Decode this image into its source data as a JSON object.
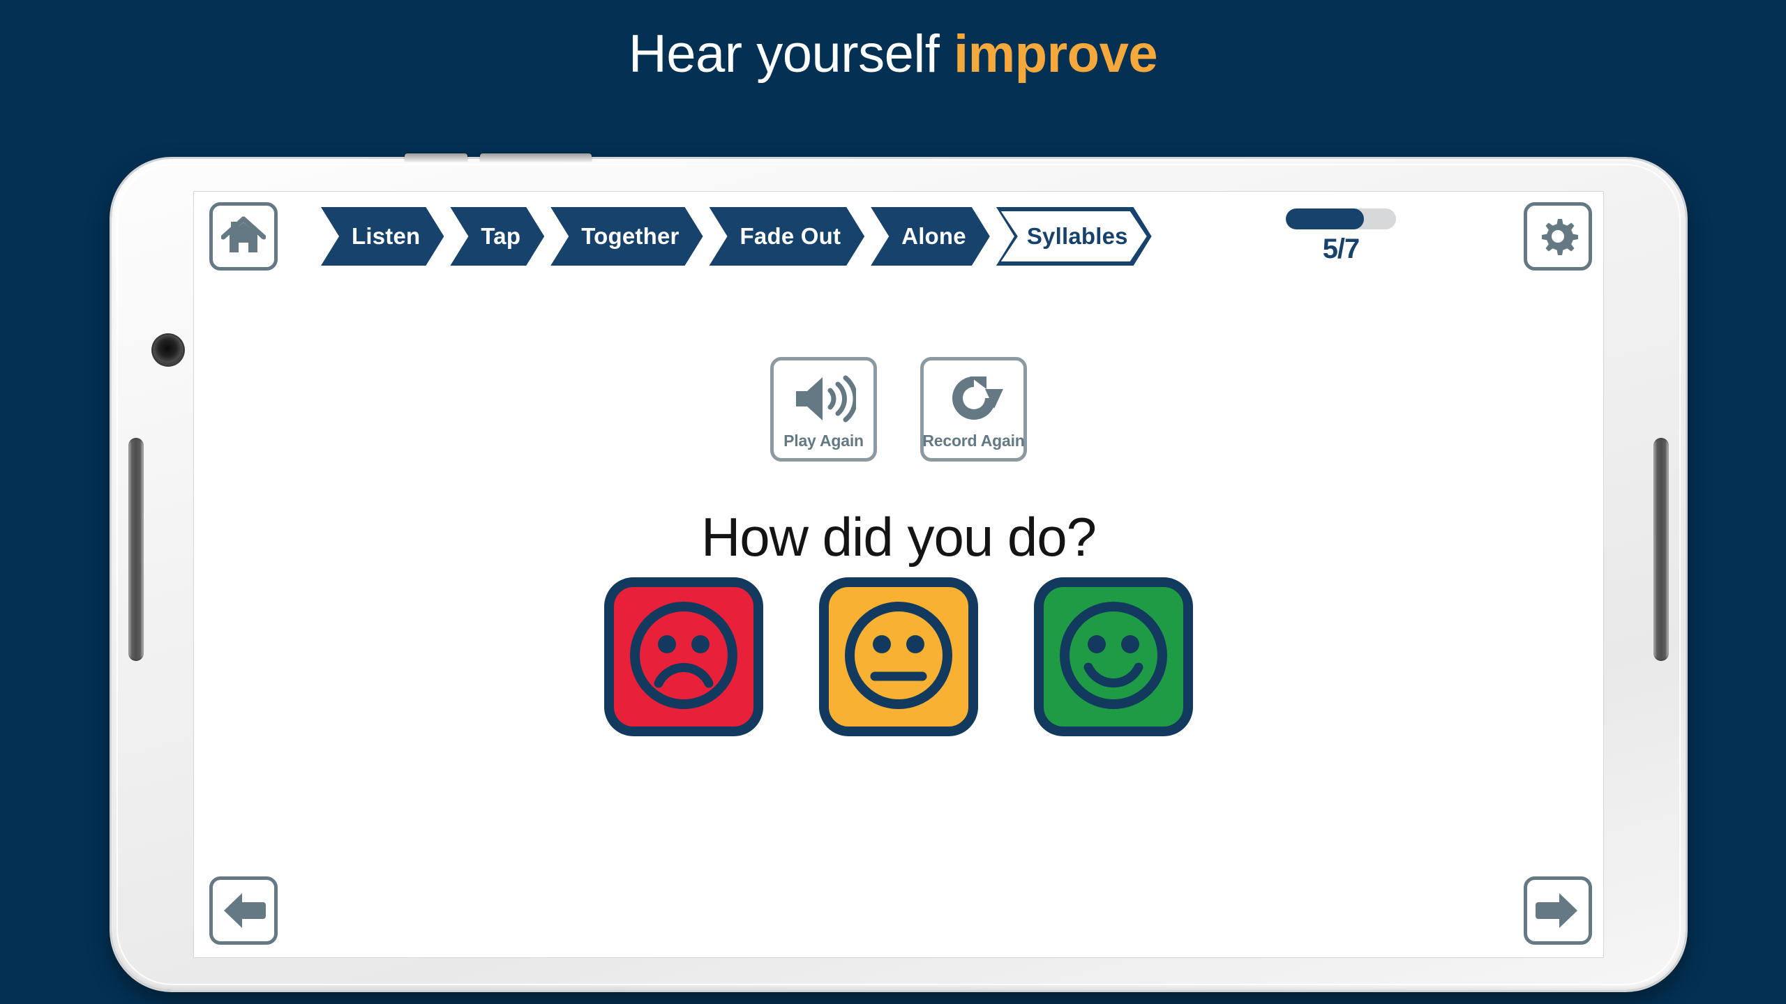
{
  "headline": {
    "text_plain": "Hear yourself ",
    "accent": "improve",
    "accent_color": "#f5a93c",
    "text_color": "#ffffff"
  },
  "background_color": "#033053",
  "device": {
    "frame_color": "#f2f2f2",
    "hardware": {
      "power_button": "power-button",
      "volume_button": "volume-button",
      "camera": "front-camera",
      "left_speaker": "left-speaker-grille",
      "right_speaker": "right-speaker-grille"
    }
  },
  "app": {
    "topbar": {
      "home_button": {
        "icon": "home-icon",
        "label": "Home"
      },
      "settings_button": {
        "icon": "gear-icon",
        "label": "Settings"
      },
      "breadcrumb": {
        "steps": [
          {
            "label": "Listen",
            "active": false
          },
          {
            "label": "Tap",
            "active": false
          },
          {
            "label": "Together",
            "active": false
          },
          {
            "label": "Fade Out",
            "active": false
          },
          {
            "label": "Alone",
            "active": false
          },
          {
            "label": "Syllables",
            "active": true
          }
        ],
        "active_color": "#ffffff",
        "inactive_color": "#17426b"
      },
      "progress": {
        "current": 5,
        "total": 7,
        "label": "5/7",
        "percent": 71,
        "fill_color": "#17426b",
        "track_color": "#d6d8da"
      }
    },
    "actions": [
      {
        "icon": "speaker-volume-icon",
        "label": "Play Again"
      },
      {
        "icon": "refresh-redo-icon",
        "label": "Record Again"
      }
    ],
    "prompt": "How did you do?",
    "rating_faces": [
      {
        "name": "sad-face",
        "label": "Sad",
        "color": "#e8203a",
        "outline": "#123a5e",
        "mouth": "frown"
      },
      {
        "name": "neutral-face",
        "label": "Neutral",
        "color": "#f8b133",
        "outline": "#123a5e",
        "mouth": "straight"
      },
      {
        "name": "happy-face",
        "label": "Happy",
        "color": "#1e9b44",
        "outline": "#123a5e",
        "mouth": "smile"
      }
    ],
    "footer": {
      "back_button": {
        "icon": "arrow-left-icon",
        "label": "Back"
      },
      "forward_button": {
        "icon": "arrow-right-icon",
        "label": "Next"
      }
    }
  },
  "icon_color": "#647983"
}
